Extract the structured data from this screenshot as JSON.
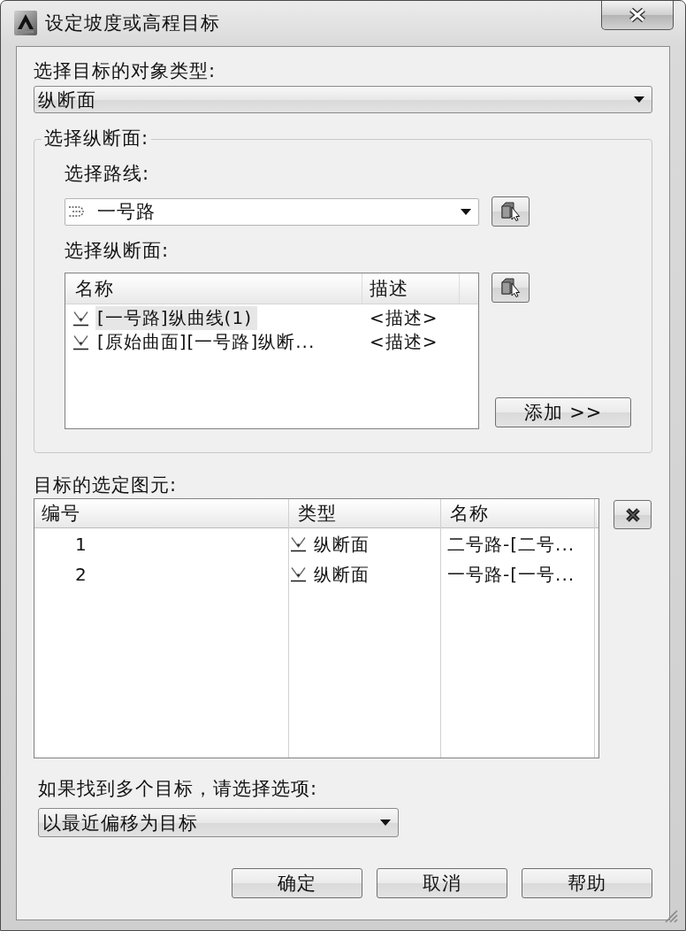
{
  "window": {
    "title": "设定坡度或高程目标"
  },
  "object_type": {
    "label": "选择目标的对象类型:",
    "value": "纵断面"
  },
  "profile_group": {
    "title": "选择纵断面:",
    "route_label": "选择路线:",
    "route": {
      "value": "一号路"
    },
    "profile_label": "选择纵断面:",
    "profile_list": {
      "columns": [
        "名称",
        "描述"
      ],
      "rows": [
        {
          "name": "[一号路]纵曲线(1)",
          "description": "<描述>",
          "selected": true
        },
        {
          "name": "[原始曲面][一号路]纵断...",
          "description": "<描述>",
          "selected": false
        }
      ]
    },
    "add_button": "添加 >>"
  },
  "selected_targets": {
    "label": "目标的选定图元:",
    "columns": [
      "编号",
      "类型",
      "名称"
    ],
    "rows": [
      {
        "number": "1",
        "type": "纵断面",
        "name": "二号路-[二号..."
      },
      {
        "number": "2",
        "type": "纵断面",
        "name": "一号路-[一号..."
      }
    ]
  },
  "multiple_targets": {
    "label": "如果找到多个目标，请选择选项:",
    "value": "以最近偏移为目标"
  },
  "buttons": [
    "确定",
    "取消",
    "帮助"
  ]
}
